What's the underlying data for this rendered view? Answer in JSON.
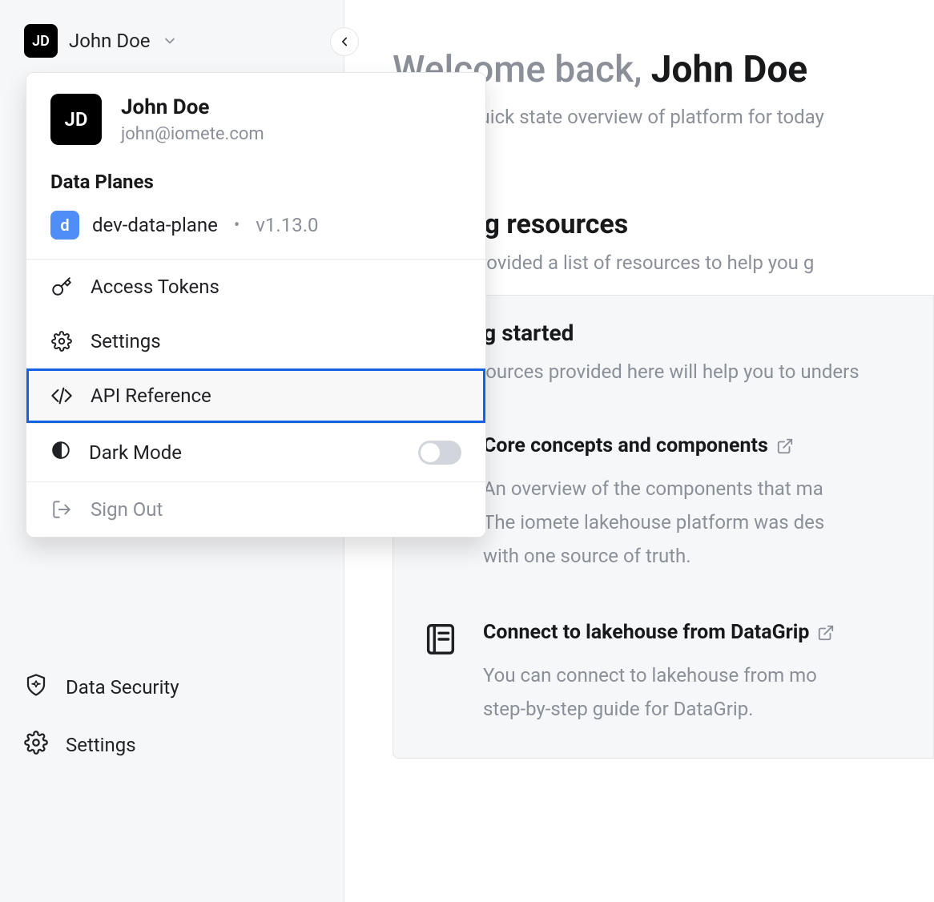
{
  "user": {
    "initials": "JD",
    "name": "John Doe",
    "email": "john@iomete.com"
  },
  "dropdown": {
    "data_planes_title": "Data Planes",
    "data_plane": {
      "badge": "d",
      "name": "dev-data-plane",
      "version": "v1.13.0"
    },
    "access_tokens": "Access Tokens",
    "settings": "Settings",
    "api_reference": "API Reference",
    "dark_mode": "Dark Mode",
    "sign_out": "Sign Out"
  },
  "sidebar": {
    "data_security": "Data Security",
    "settings": "Settings"
  },
  "main": {
    "welcome_muted": "Welcome back, ",
    "welcome_name": "John Doe",
    "welcome_sub": "This is a quick state overview of platform for today",
    "resources_title": "Learning resources",
    "resources_sub": "We have provided a list of resources to help you g",
    "panel_title": "Getting started",
    "panel_sub": "The resources provided here will help you to unders",
    "card1": {
      "title": "Core concepts and components",
      "desc": "An overview of the components that ma\nThe iomete lakehouse platform was des\nwith one source of truth."
    },
    "card2": {
      "title": "Connect to lakehouse from DataGrip",
      "desc": "You can connect to lakehouse from mo\nstep-by-step guide for DataGrip."
    }
  }
}
